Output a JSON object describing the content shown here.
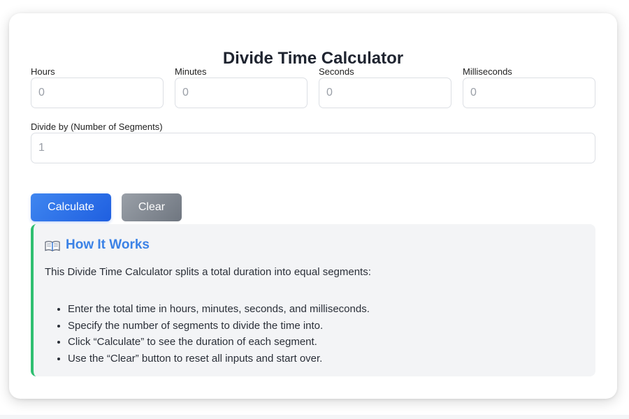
{
  "title": "Divide Time Calculator",
  "fields": {
    "hours": {
      "label": "Hours",
      "placeholder": "0"
    },
    "minutes": {
      "label": "Minutes",
      "placeholder": "0"
    },
    "seconds": {
      "label": "Seconds",
      "placeholder": "0"
    },
    "milliseconds": {
      "label": "Milliseconds",
      "placeholder": "0"
    },
    "divide_by": {
      "label": "Divide by (Number of Segments)",
      "placeholder": "1"
    }
  },
  "buttons": {
    "calculate": "Calculate",
    "clear": "Clear"
  },
  "info": {
    "icon": "open-book-icon",
    "heading": "How It Works",
    "intro": "This Divide Time Calculator splits a total duration into equal segments:",
    "steps": [
      "Enter the total time in hours, minutes, seconds, and milliseconds.",
      "Specify the number of segments to divide the time into.",
      "Click “Calculate” to see the duration of each segment.",
      "Use the “Clear” button to reset all inputs and start over."
    ]
  },
  "colors": {
    "primary_button": "#2f72ea",
    "secondary_button": "#868c95",
    "info_accent": "#2fbf71",
    "heading_accent": "#3b82e6"
  }
}
